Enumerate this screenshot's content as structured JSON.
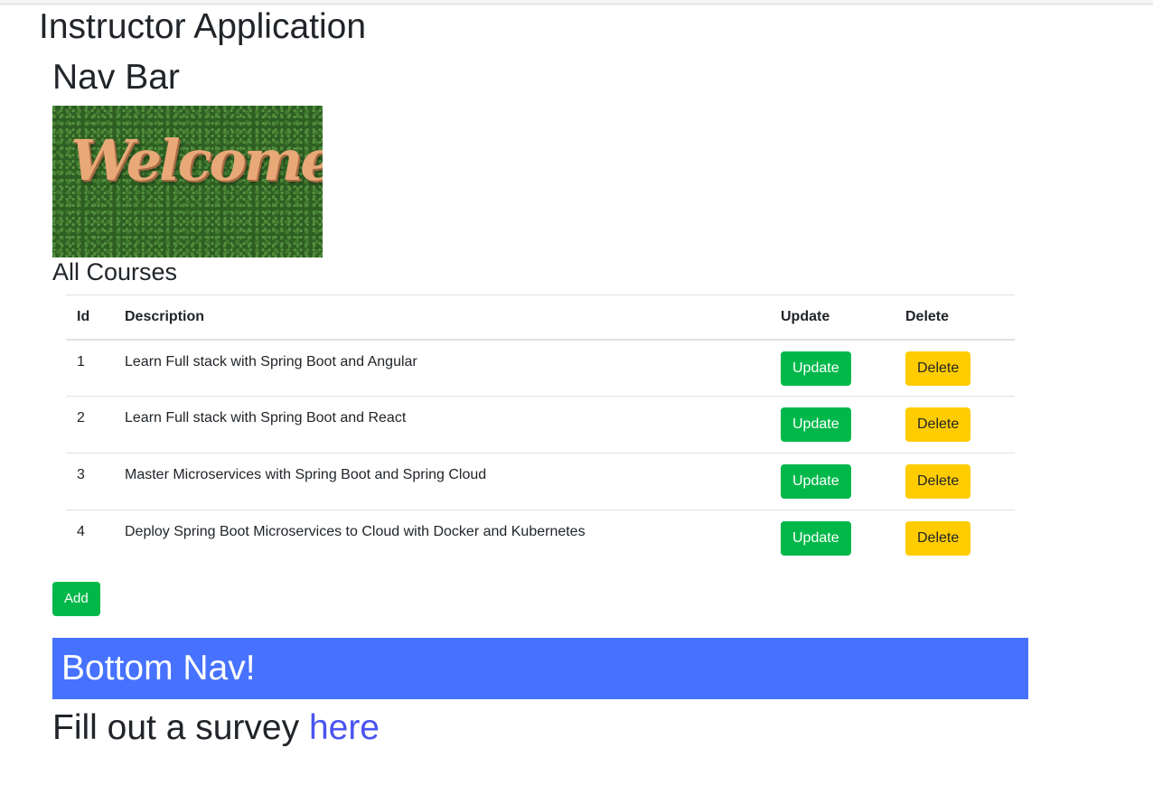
{
  "app": {
    "title": "Instructor Application"
  },
  "nav": {
    "title": "Nav Bar"
  },
  "banner": {
    "image_text": "Welcome"
  },
  "courses": {
    "section_title": "All Courses",
    "columns": [
      "Id",
      "Description",
      "Update",
      "Delete"
    ],
    "rows": [
      {
        "id": "1",
        "description": "Learn Full stack with Spring Boot and Angular",
        "update_label": "Update",
        "delete_label": "Delete"
      },
      {
        "id": "2",
        "description": "Learn Full stack with Spring Boot and React",
        "update_label": "Update",
        "delete_label": "Delete"
      },
      {
        "id": "3",
        "description": "Master Microservices with Spring Boot and Spring Cloud",
        "update_label": "Update",
        "delete_label": "Delete"
      },
      {
        "id": "4",
        "description": "Deploy Spring Boot Microservices to Cloud with Docker and Kubernetes",
        "update_label": "Update",
        "delete_label": "Delete"
      }
    ],
    "add_label": "Add"
  },
  "bottom_nav": {
    "text": "Bottom Nav!"
  },
  "survey": {
    "prefix": "Fill out a survey ",
    "link_text": "here"
  },
  "colors": {
    "success": "#00b84a",
    "warning": "#ffcc00",
    "bottom_nav_bg": "#4672ff",
    "link": "#4a54f1"
  }
}
